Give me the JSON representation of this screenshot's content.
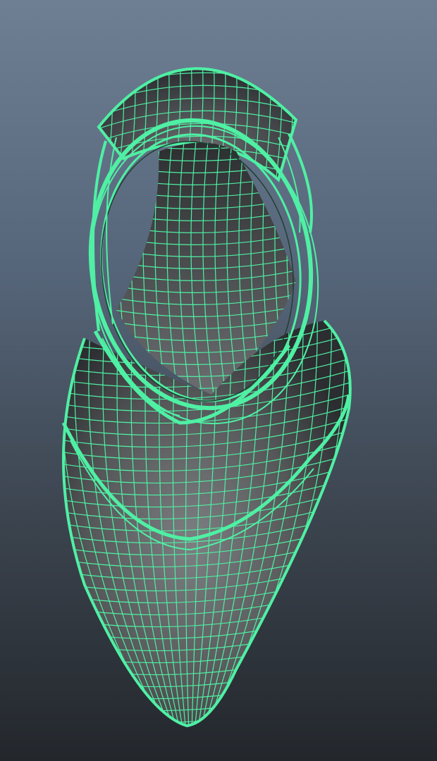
{
  "viewport": {
    "background_top": "#6e7f94",
    "background_bottom": "#23272c"
  },
  "model": {
    "object": "shoe-mesh",
    "display_mode": "wireframe-on-shaded",
    "selected": true,
    "wire_color": "#4ff0a4",
    "shade_dark": "#2a2c2e",
    "shade_light": "#8a8c8e"
  }
}
